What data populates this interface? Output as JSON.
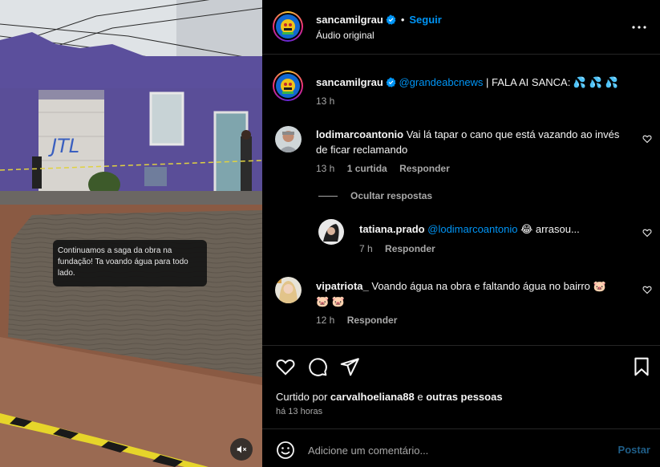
{
  "video": {
    "caption_overlay": "Continuamos a saga da obra na fundação! Ta voando água para todo lado.",
    "graffiti_text": "JTL",
    "mute_icon": "speaker-muted-icon"
  },
  "header": {
    "username": "sancamilgrau",
    "separator": "•",
    "follow_label": "Seguir",
    "audio_label": "Áudio original",
    "more_icon": "more-horizontal-icon"
  },
  "post_caption": {
    "username": "sancamilgrau",
    "mention": "@grandeabcnews",
    "text": " | FALA AI SANCA: 💦 💦 💦",
    "time": "13 h"
  },
  "comments": [
    {
      "username": "lodimarcoantonio",
      "text": "Vai lá tapar o cano que está vazando ao invés de ficar reclamando",
      "time": "13 h",
      "likes": "1 curtida",
      "reply_label": "Responder"
    },
    {
      "username": "tatiana.prado",
      "mention": "@lodimarcoantonio",
      "text": " 😂 arrasou...",
      "time": "7 h",
      "reply_label": "Responder"
    },
    {
      "username": "vipatriota_",
      "text": "Voando água na obra e faltando água no bairro 🐷 🐷 🐷",
      "time": "12 h",
      "reply_label": "Responder"
    }
  ],
  "hide_replies_label": "Ocultar respostas",
  "footer": {
    "liked_by_prefix": "Curtido por ",
    "liked_by_user": "carvalhoeliana88",
    "liked_by_and": " e ",
    "liked_by_others": "outras pessoas",
    "time_ago": "há 13 horas",
    "comment_placeholder": "Adicione um comentário...",
    "post_label": "Postar"
  },
  "colors": {
    "accent": "#0095f6",
    "secondary_text": "#a8a8a8",
    "background": "#000000"
  }
}
